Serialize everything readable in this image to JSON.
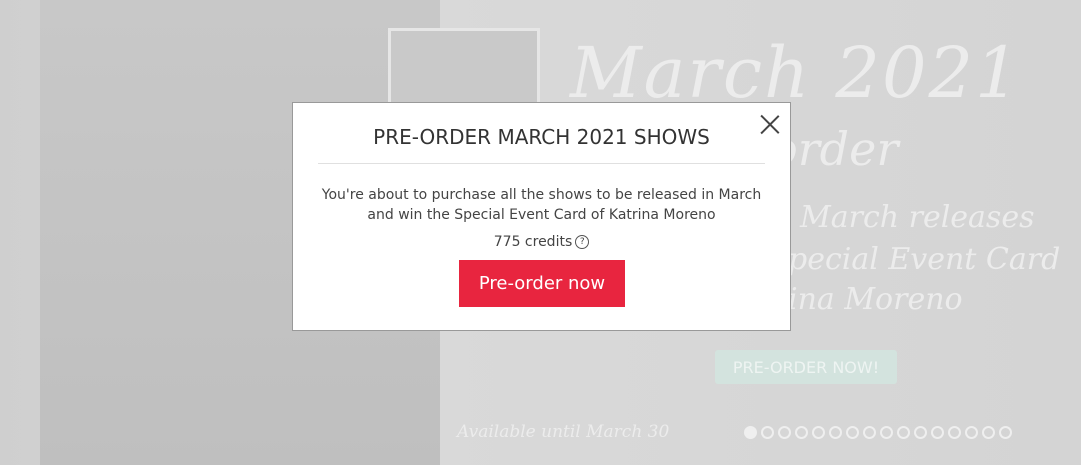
{
  "banner": {
    "image_placeholder_label": "",
    "headline": "March 2021",
    "subheadline": "order",
    "line1": "March releases",
    "line2": "pecial Event Card",
    "line3": "ina Moreno",
    "button_label": "PRE-ORDER NOW!",
    "availability": "Available until March 30",
    "carousel": {
      "total_slides": 16,
      "active_index": 0
    }
  },
  "modal": {
    "title": "PRE-ORDER MARCH 2021 SHOWS",
    "description": "You're about to purchase all the shows to be released in March and win the Special Event Card of Katrina Moreno",
    "credits": "775 credits",
    "help_icon_glyph": "?",
    "cta_label": "Pre-order now",
    "close_icon": "close-icon"
  },
  "colors": {
    "accent": "#e8253f"
  }
}
